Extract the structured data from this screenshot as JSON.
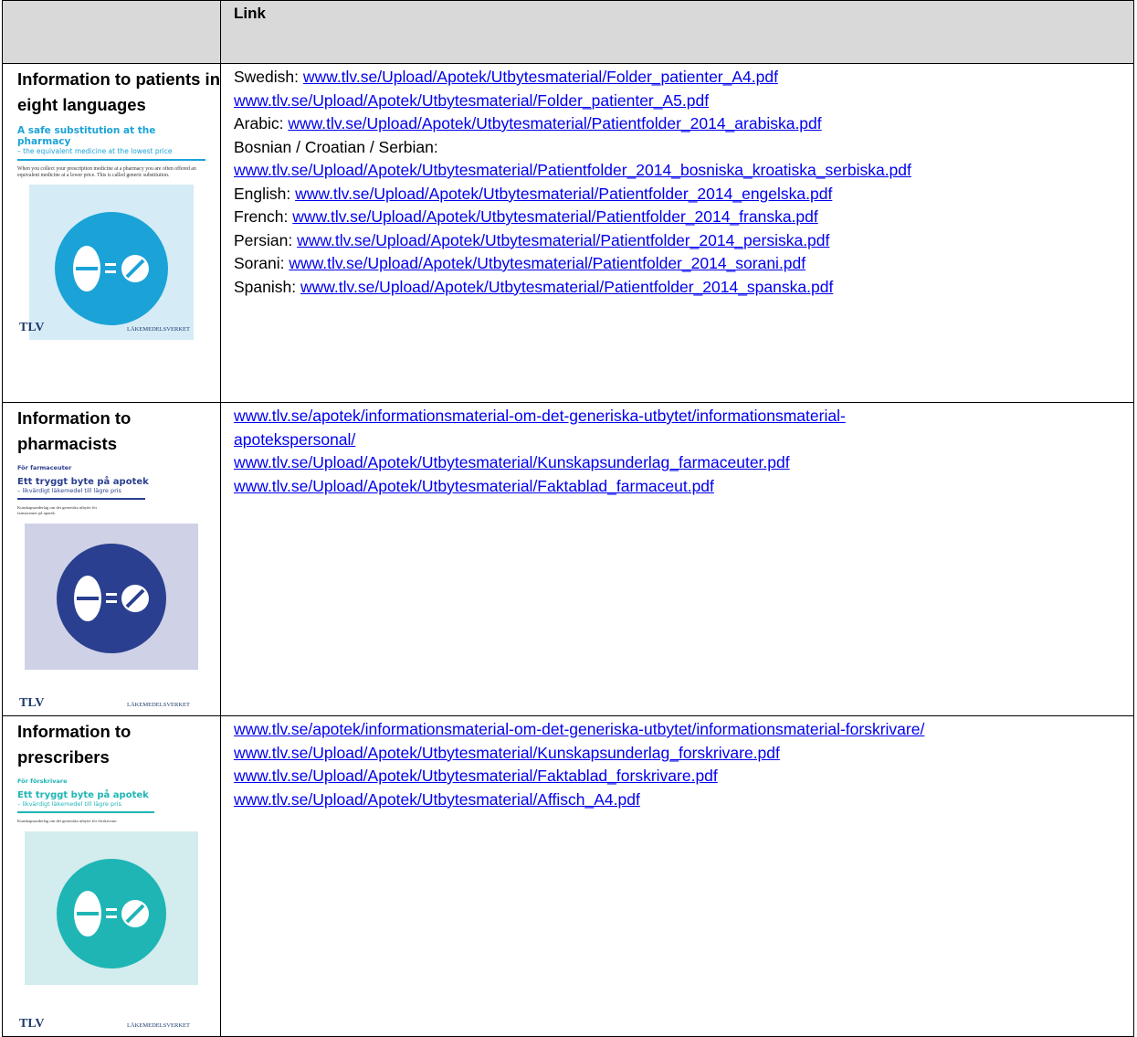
{
  "header": {
    "col1": "",
    "col2": "Link"
  },
  "colors": {
    "link": "#0000ee",
    "header_bg": "#d9d9d9"
  },
  "rows": [
    {
      "label": "Information to patients in eight languages",
      "thumbnail": {
        "title": "A safe substitution at the pharmacy",
        "subtitle": "– the equivalent medicine at the lowest price",
        "body": "When you collect your prescription medicine at a pharmacy you are often offered an equivalent medicine at a lower price. This is called generic substitution.",
        "logo_left": "TLV",
        "logo_right": "LÄKEMEDELSVERKET",
        "accent": "#1ba3d8",
        "panel_bg": "#d5ecf6"
      },
      "lines": [
        {
          "prefix": "Swedish: ",
          "link": "www.tlv.se/Upload/Apotek/Utbytesmaterial/Folder_patienter_A4.pdf"
        },
        {
          "prefix": "",
          "link": "www.tlv.se/Upload/Apotek/Utbytesmaterial/Folder_patienter_A5.pdf"
        },
        {
          "prefix": "Arabic: ",
          "link": "www.tlv.se/Upload/Apotek/Utbytesmaterial/Patientfolder_2014_arabiska.pdf"
        },
        {
          "prefix": "Bosnian / Croatian / Serbian:",
          "link": ""
        },
        {
          "prefix": "",
          "link": "www.tlv.se/Upload/Apotek/Utbytesmaterial/Patientfolder_2014_bosniska_kroatiska_serbiska.pdf"
        },
        {
          "prefix": "English: ",
          "link": "www.tlv.se/Upload/Apotek/Utbytesmaterial/Patientfolder_2014_engelska.pdf"
        },
        {
          "prefix": "French: ",
          "link": "www.tlv.se/Upload/Apotek/Utbytesmaterial/Patientfolder_2014_franska.pdf"
        },
        {
          "prefix": "Persian: ",
          "link": "www.tlv.se/Upload/Apotek/Utbytesmaterial/Patientfolder_2014_persiska.pdf"
        },
        {
          "prefix": "Sorani: ",
          "link": "www.tlv.se/Upload/Apotek/Utbytesmaterial/Patientfolder_2014_sorani.pdf"
        },
        {
          "prefix": "Spanish: ",
          "link": "www.tlv.se/Upload/Apotek/Utbytesmaterial/Patientfolder_2014_spanska.pdf"
        }
      ]
    },
    {
      "label": "Information to pharmacists",
      "thumbnail": {
        "kicker": "För farmaceuter",
        "title": "Ett tryggt byte på apotek",
        "subtitle": "– likvärdigt läkemedel till lägre pris",
        "body": "Kunskapsunderlag om det generiska utbytet för farmaceuter på apotek.",
        "logo_left": "TLV",
        "logo_right": "LÄKEMEDELSVERKET",
        "accent": "#2a3f8f",
        "panel_bg": "#cfd1e6"
      },
      "lines": [
        {
          "prefix": "",
          "link": "www.tlv.se/apotek/informationsmaterial-om-det-generiska-utbytet/informationsmaterial-"
        },
        {
          "prefix": "",
          "link": "apotekspersonal/"
        },
        {
          "prefix": "",
          "link": "www.tlv.se/Upload/Apotek/Utbytesmaterial/Kunskapsunderlag_farmaceuter.pdf"
        },
        {
          "prefix": "",
          "link": "www.tlv.se/Upload/Apotek/Utbytesmaterial/Faktablad_farmaceut.pdf"
        }
      ]
    },
    {
      "label": "Information to prescribers",
      "thumbnail": {
        "kicker": "För förskrivare",
        "title": "Ett tryggt byte på apotek",
        "subtitle": "– likvärdigt läkemedel till lägre pris",
        "body": "Kunskapsunderlag om det generiska utbytet för förskrivare.",
        "logo_left": "TLV",
        "logo_right": "LÄKEMEDELSVERKET",
        "accent": "#1fb5b5",
        "panel_bg": "#d3ecee"
      },
      "lines": [
        {
          "prefix": "",
          "link": "www.tlv.se/apotek/informationsmaterial-om-det-generiska-utbytet/informationsmaterial-forskrivare/"
        },
        {
          "prefix": "",
          "link": "www.tlv.se/Upload/Apotek/Utbytesmaterial/Kunskapsunderlag_forskrivare.pdf"
        },
        {
          "prefix": "",
          "link": "www.tlv.se/Upload/Apotek/Utbytesmaterial/Faktablad_forskrivare.pdf"
        },
        {
          "prefix": "",
          "link": "www.tlv.se/Upload/Apotek/Utbytesmaterial/Affisch_A4.pdf"
        }
      ]
    }
  ]
}
